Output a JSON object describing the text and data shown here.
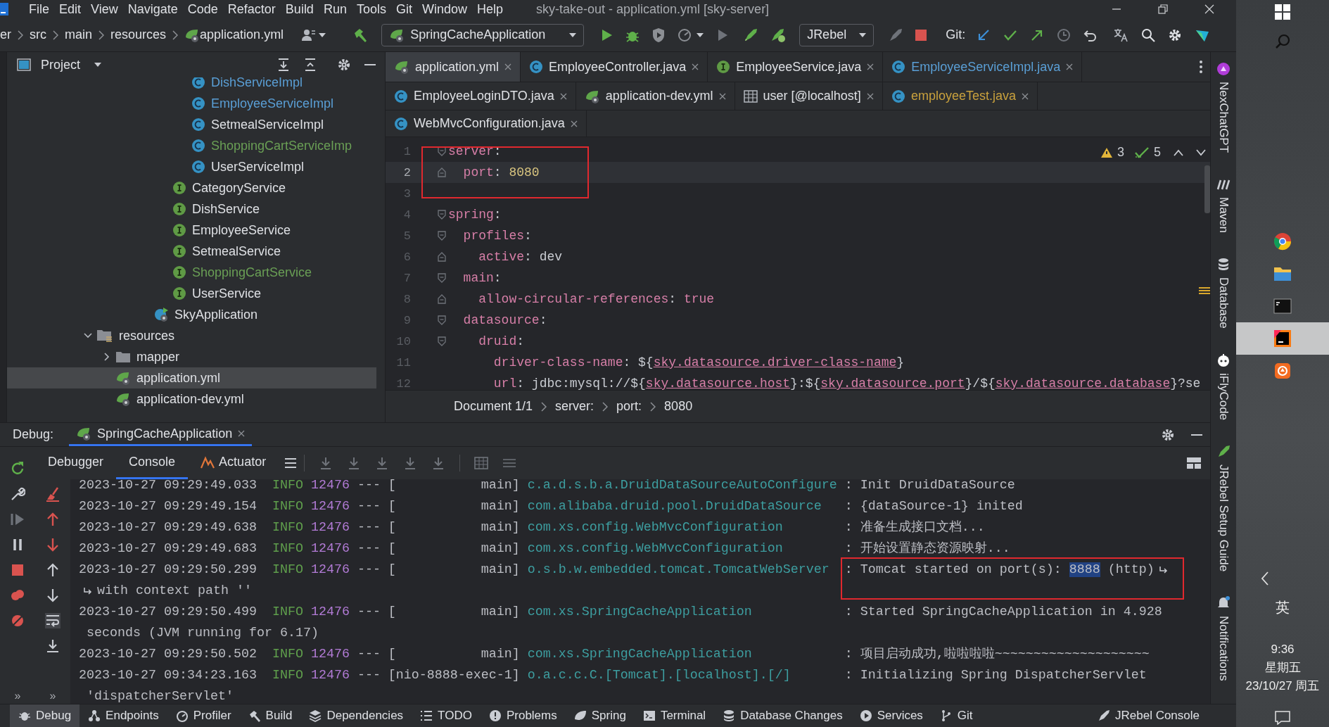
{
  "menu": {
    "items": [
      "File",
      "Edit",
      "View",
      "Navigate",
      "Code",
      "Refactor",
      "Build",
      "Run",
      "Tools",
      "Git",
      "Window",
      "Help"
    ],
    "title": "sky-take-out - application.yml [sky-server]"
  },
  "navbar": {
    "path": [
      {
        "label": "er"
      },
      {
        "label": "src"
      },
      {
        "label": "main"
      },
      {
        "label": "resources"
      },
      {
        "label": "application.yml",
        "kind": "spring-config"
      }
    ],
    "run_config": "SpringCacheApplication",
    "jrebel": "JRebel",
    "git_label": "Git:"
  },
  "project": {
    "title": "Project",
    "tree": [
      {
        "children": [
          {
            "children": [
              {
                "children": [
                  {
                    "children": [
                      {
                        "children": [
                          {
                            "label": "DishServiceImpl",
                            "kind": "class",
                            "color": "#5a9fd6",
                            "selected": false
                          },
                          {
                            "label": "EmployeeServiceImpl",
                            "kind": "class",
                            "color": "#5a9fd6",
                            "selected": false
                          },
                          {
                            "label": "SetmealServiceImpl",
                            "kind": "class",
                            "color": "#dfe1e5",
                            "selected": false
                          },
                          {
                            "label": "ShoppingCartServiceImp",
                            "kind": "class",
                            "color": "#6a9f55",
                            "selected": false
                          },
                          {
                            "label": "UserServiceImpl",
                            "kind": "class",
                            "color": "#dfe1e5",
                            "selected": false
                          }
                        ]
                      },
                      {
                        "label": "CategoryService",
                        "kind": "interface",
                        "color": "#dfe1e5",
                        "selected": false
                      },
                      {
                        "label": "DishService",
                        "kind": "interface",
                        "color": "#dfe1e5",
                        "selected": false
                      },
                      {
                        "label": "EmployeeService",
                        "kind": "interface",
                        "color": "#dfe1e5",
                        "selected": false
                      },
                      {
                        "label": "SetmealService",
                        "kind": "interface",
                        "color": "#dfe1e5",
                        "selected": false
                      },
                      {
                        "label": "ShoppingCartService",
                        "kind": "interface",
                        "color": "#6a9f55",
                        "selected": false
                      },
                      {
                        "label": "UserService",
                        "kind": "interface",
                        "color": "#dfe1e5",
                        "selected": false
                      }
                    ]
                  },
                  {
                    "label": "SkyApplication",
                    "kind": "spring-app",
                    "color": "#dfe1e5",
                    "selected": false
                  }
                ]
              }
            ]
          }
        ]
      },
      {
        "label": "resources",
        "kind": "resources-folder",
        "color": "#dfe1e5",
        "selected": false,
        "expanded": true,
        "children": [
          {
            "label": "mapper",
            "kind": "folder",
            "color": "#dfe1e5",
            "selected": false,
            "expanded": false
          },
          {
            "label": "application.yml",
            "kind": "spring-config",
            "color": "#dfe1e5",
            "selected": true
          },
          {
            "label": "application-dev.yml",
            "kind": "spring-config",
            "color": "#dfe1e5",
            "selected": false
          }
        ]
      }
    ]
  },
  "editor": {
    "tab_rows": [
      [
        {
          "label": "application.yml",
          "kind": "spring-config",
          "color": "#dfe1e5",
          "selected": true
        },
        {
          "label": "EmployeeController.java",
          "kind": "class",
          "color": "#dfe1e5",
          "selected": false
        },
        {
          "label": "EmployeeService.java",
          "kind": "interface",
          "color": "#dfe1e5",
          "selected": false
        },
        {
          "label": "EmployeeServiceImpl.java",
          "kind": "class",
          "color": "#5a9fd6",
          "selected": false
        }
      ],
      [
        {
          "label": "EmployeeLoginDTO.java",
          "kind": "class",
          "color": "#dfe1e5",
          "selected": false
        },
        {
          "label": "application-dev.yml",
          "kind": "spring-config",
          "color": "#dfe1e5",
          "selected": false
        },
        {
          "label": "user [@localhost]",
          "kind": "table",
          "color": "#dfe1e5",
          "selected": false
        },
        {
          "label": "employeeTest.java",
          "kind": "class",
          "color": "#c9a13d",
          "selected": false
        }
      ],
      [
        {
          "label": "WebMvcConfiguration.java",
          "kind": "class",
          "color": "#dfe1e5",
          "selected": false
        }
      ]
    ],
    "lines": [
      {
        "number": "1",
        "kind": "fold-start",
        "boxed": true,
        "current": false,
        "tokens": [
          {
            "t": "server",
            "kind": "key"
          },
          {
            "t": ":",
            "kind": "punct"
          }
        ]
      },
      {
        "number": "2",
        "kind": "fold-end",
        "boxed": true,
        "current": true,
        "tokens": [
          {
            "t": "  port",
            "kind": "key"
          },
          {
            "t": ": ",
            "kind": "punct"
          },
          {
            "t": "8080",
            "kind": "number"
          }
        ]
      },
      {
        "number": "3",
        "kind": "plain",
        "boxed": true,
        "current": false
      },
      {
        "number": "4",
        "kind": "fold-start",
        "boxed": false,
        "current": false,
        "tokens": [
          {
            "t": "spring",
            "kind": "key"
          },
          {
            "t": ":",
            "kind": "punct"
          }
        ]
      },
      {
        "number": "5",
        "kind": "fold-start",
        "boxed": false,
        "current": false,
        "tokens": [
          {
            "t": "  profiles",
            "kind": "key"
          },
          {
            "t": ":",
            "kind": "punct"
          }
        ]
      },
      {
        "number": "6",
        "kind": "fold-end",
        "boxed": false,
        "current": false,
        "tokens": [
          {
            "t": "    active",
            "kind": "key"
          },
          {
            "t": ": ",
            "kind": "punct"
          },
          {
            "t": "dev",
            "kind": "plain"
          }
        ]
      },
      {
        "number": "7",
        "kind": "fold-start",
        "boxed": false,
        "current": false,
        "tokens": [
          {
            "t": "  main",
            "kind": "key"
          },
          {
            "t": ":",
            "kind": "punct"
          }
        ]
      },
      {
        "number": "8",
        "kind": "fold-end",
        "boxed": false,
        "current": false,
        "tokens": [
          {
            "t": "    allow-circular-references",
            "kind": "key"
          },
          {
            "t": ": ",
            "kind": "punct"
          },
          {
            "t": "true",
            "kind": "bool"
          }
        ]
      },
      {
        "number": "9",
        "kind": "fold-start",
        "boxed": false,
        "current": false,
        "tokens": [
          {
            "t": "  datasource",
            "kind": "key"
          },
          {
            "t": ":",
            "kind": "punct"
          }
        ]
      },
      {
        "number": "10",
        "kind": "fold-start",
        "boxed": false,
        "current": false,
        "tokens": [
          {
            "t": "    druid",
            "kind": "key"
          },
          {
            "t": ":",
            "kind": "punct"
          }
        ]
      },
      {
        "number": "11",
        "kind": "plain",
        "boxed": false,
        "current": false,
        "tokens": [
          {
            "t": "      driver-class-name",
            "kind": "key"
          },
          {
            "t": ": ${",
            "kind": "punct"
          },
          {
            "t": "sky.datasource.driver-class-name",
            "kind": "link"
          },
          {
            "t": "}",
            "kind": "punct"
          }
        ]
      },
      {
        "number": "12",
        "kind": "plain",
        "boxed": false,
        "current": false,
        "tokens": [
          {
            "t": "      url",
            "kind": "key"
          },
          {
            "t": ": ",
            "kind": "punct"
          },
          {
            "t": "jdbc:mysql://${",
            "kind": "plain"
          },
          {
            "t": "sky.datasource.host",
            "kind": "link"
          },
          {
            "t": "}:${",
            "kind": "plain"
          },
          {
            "t": "sky.datasource.port",
            "kind": "link"
          },
          {
            "t": "}/${",
            "kind": "plain"
          },
          {
            "t": "sky.datasource.database",
            "kind": "link"
          },
          {
            "t": "}?se",
            "kind": "plain"
          }
        ]
      }
    ],
    "warnings": "3",
    "checks": "5",
    "breadcrumb": [
      "Document 1/1",
      "server:",
      "port:",
      "8080"
    ]
  },
  "tool_strip": [
    {
      "label": "NexChatGPT",
      "kind": "chatgpt"
    },
    {
      "label": "Maven",
      "kind": "maven"
    },
    {
      "label": "Database",
      "kind": "database"
    },
    {
      "label": "iFlyCode",
      "kind": "iflycode"
    },
    {
      "label": "JRebel Setup Guide",
      "kind": "jrebel"
    },
    {
      "label": "Notifications",
      "kind": "notifications"
    }
  ],
  "debug": {
    "label": "Debug:",
    "session": "SpringCacheApplication",
    "tabs": [
      {
        "label": "Debugger",
        "selected": false
      },
      {
        "label": "Console",
        "selected": true
      },
      {
        "label": "Actuator",
        "selected": false
      }
    ],
    "overflow": [
      "»",
      "»"
    ],
    "entries": [
      {
        "time": "2023-10-27 09:29:49.033",
        "level": "INFO",
        "pid": "12476",
        "sep": "---",
        "thread": "[           main]",
        "logger": "c.a.d.s.b.a.DruidDataSourceAutoConfigure",
        "message": [
          {
            "text": ": Init DruidDataSource",
            "selected": false
          }
        ],
        "soft_wrap": false,
        "boxed": false
      },
      {
        "time": "2023-10-27 09:29:49.154",
        "level": "INFO",
        "pid": "12476",
        "sep": "---",
        "thread": "[           main]",
        "logger": "com.alibaba.druid.pool.DruidDataSource",
        "message": [
          {
            "text": ": {dataSource-1} inited",
            "selected": false
          }
        ],
        "soft_wrap": false,
        "boxed": false
      },
      {
        "time": "2023-10-27 09:29:49.638",
        "level": "INFO",
        "pid": "12476",
        "sep": "---",
        "thread": "[           main]",
        "logger": "com.xs.config.WebMvcConfiguration",
        "message": [
          {
            "text": ": 准备生成接口文档...",
            "selected": false
          }
        ],
        "soft_wrap": false,
        "boxed": false
      },
      {
        "time": "2023-10-27 09:29:49.683",
        "level": "INFO",
        "pid": "12476",
        "sep": "---",
        "thread": "[           main]",
        "logger": "com.xs.config.WebMvcConfiguration",
        "message": [
          {
            "text": ": 开始设置静态资源映射...",
            "selected": false
          }
        ],
        "soft_wrap": false,
        "boxed": false
      },
      {
        "time": "2023-10-27 09:29:50.299",
        "level": "INFO",
        "pid": "12476",
        "sep": "---",
        "thread": "[           main]",
        "logger": "o.s.b.w.embedded.tomcat.TomcatWebServer",
        "message": [
          {
            "text": ": Tomcat started on port(s): ",
            "selected": false
          },
          {
            "text": "8888",
            "selected": true
          },
          {
            "text": " (http)",
            "selected": false
          }
        ],
        "continuation": "with context path ''",
        "soft_wrap": true,
        "boxed": true
      },
      {
        "time": "2023-10-27 09:29:50.499",
        "level": "INFO",
        "pid": "12476",
        "sep": "---",
        "thread": "[           main]",
        "logger": "com.xs.SpringCacheApplication",
        "message": [
          {
            "text": ": Started SpringCacheApplication in 4.928",
            "selected": false
          }
        ],
        "continuation": " seconds (JVM running for 6.17)",
        "soft_wrap": false,
        "boxed": false
      },
      {
        "time": "2023-10-27 09:29:50.502",
        "level": "INFO",
        "pid": "12476",
        "sep": "---",
        "thread": "[           main]",
        "logger": "com.xs.SpringCacheApplication",
        "message": [
          {
            "text": ": 项目启动成功,啦啦啦啦~~~~~~~~~~~~~~~~~~~~",
            "selected": false
          }
        ],
        "soft_wrap": false,
        "boxed": false
      },
      {
        "time": "2023-10-27 09:34:23.163",
        "level": "INFO",
        "pid": "12476",
        "sep": "---",
        "thread": "[nio-8888-exec-1]",
        "logger": "o.a.c.c.C.[Tomcat].[localhost].[/]",
        "message": [
          {
            "text": ": Initializing Spring DispatcherServlet",
            "selected": false
          }
        ],
        "continuation": " 'dispatcherServlet'",
        "soft_wrap": false,
        "boxed": false
      }
    ]
  },
  "bottom_bar": {
    "left": [
      {
        "label": "Debug",
        "kind": "debug",
        "selected": true
      },
      {
        "label": "Endpoints",
        "kind": "endpoints",
        "selected": false
      },
      {
        "label": "Profiler",
        "kind": "profiler",
        "selected": false
      },
      {
        "label": "Build",
        "kind": "build",
        "selected": false
      },
      {
        "label": "Dependencies",
        "kind": "dependencies",
        "selected": false
      },
      {
        "label": "TODO",
        "kind": "todo",
        "selected": false
      },
      {
        "label": "Problems",
        "kind": "problems",
        "selected": false
      },
      {
        "label": "Spring",
        "kind": "spring",
        "selected": false
      },
      {
        "label": "Terminal",
        "kind": "terminal",
        "selected": false
      },
      {
        "label": "Database Changes",
        "kind": "database",
        "selected": false
      },
      {
        "label": "Services",
        "kind": "services",
        "selected": false
      },
      {
        "label": "Git",
        "kind": "git",
        "selected": false
      }
    ],
    "right": [
      {
        "label": "JRebel Console",
        "kind": "jrebel",
        "selected": false
      }
    ]
  },
  "taskbar": {
    "apps": [
      {
        "kind": "browser",
        "selected": false
      },
      {
        "kind": "files",
        "selected": false
      },
      {
        "kind": "terminal",
        "selected": false
      },
      {
        "kind": "ide",
        "selected": true
      },
      {
        "kind": "orange-app",
        "selected": false
      }
    ],
    "ime": "英",
    "time": "9:36",
    "weekday": "星期五",
    "date": "23/10/27 周五"
  }
}
